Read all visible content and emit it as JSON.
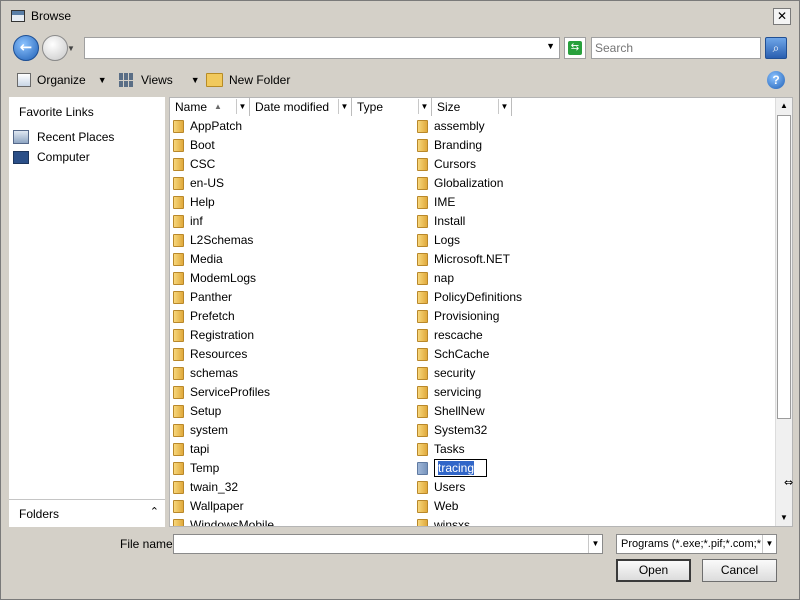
{
  "window": {
    "title": "Browse"
  },
  "address": {
    "path": "",
    "search_placeholder": "Search"
  },
  "commands": {
    "organize": "Organize",
    "views": "Views",
    "new_folder": "New Folder"
  },
  "navigation": {
    "heading": "Favorite Links",
    "items": [
      "Recent Places",
      "Computer"
    ],
    "folders_label": "Folders"
  },
  "columns": [
    "Name",
    "Date modified",
    "Type",
    "Size"
  ],
  "files": {
    "column1": [
      "AppPatch",
      "Boot",
      "CSC",
      "en-US",
      "Help",
      "inf",
      "L2Schemas",
      "Media",
      "ModemLogs",
      "Panther",
      "Prefetch",
      "Registration",
      "Resources",
      "schemas",
      "ServiceProfiles",
      "Setup",
      "system",
      "tapi",
      "Temp",
      "twain_32",
      "Wallpaper",
      "WindowsMobile"
    ],
    "column2": [
      "assembly",
      "Branding",
      "Cursors",
      "Globalization",
      "IME",
      "Install",
      "Logs",
      "Microsoft.NET",
      "nap",
      "PolicyDefinitions",
      "Provisioning",
      "rescache",
      "SchCache",
      "security",
      "servicing",
      "ShellNew",
      "System32",
      "Tasks",
      "tracing",
      "Users",
      "Web",
      "winsxs"
    ],
    "renaming": "tracing"
  },
  "bottom": {
    "file_name_label": "File name:",
    "file_name_value": "",
    "file_type": "Programs (*.exe;*.pif;*.com;*.bat;*.cmd)",
    "open_label": "Open",
    "cancel_label": "Cancel"
  }
}
